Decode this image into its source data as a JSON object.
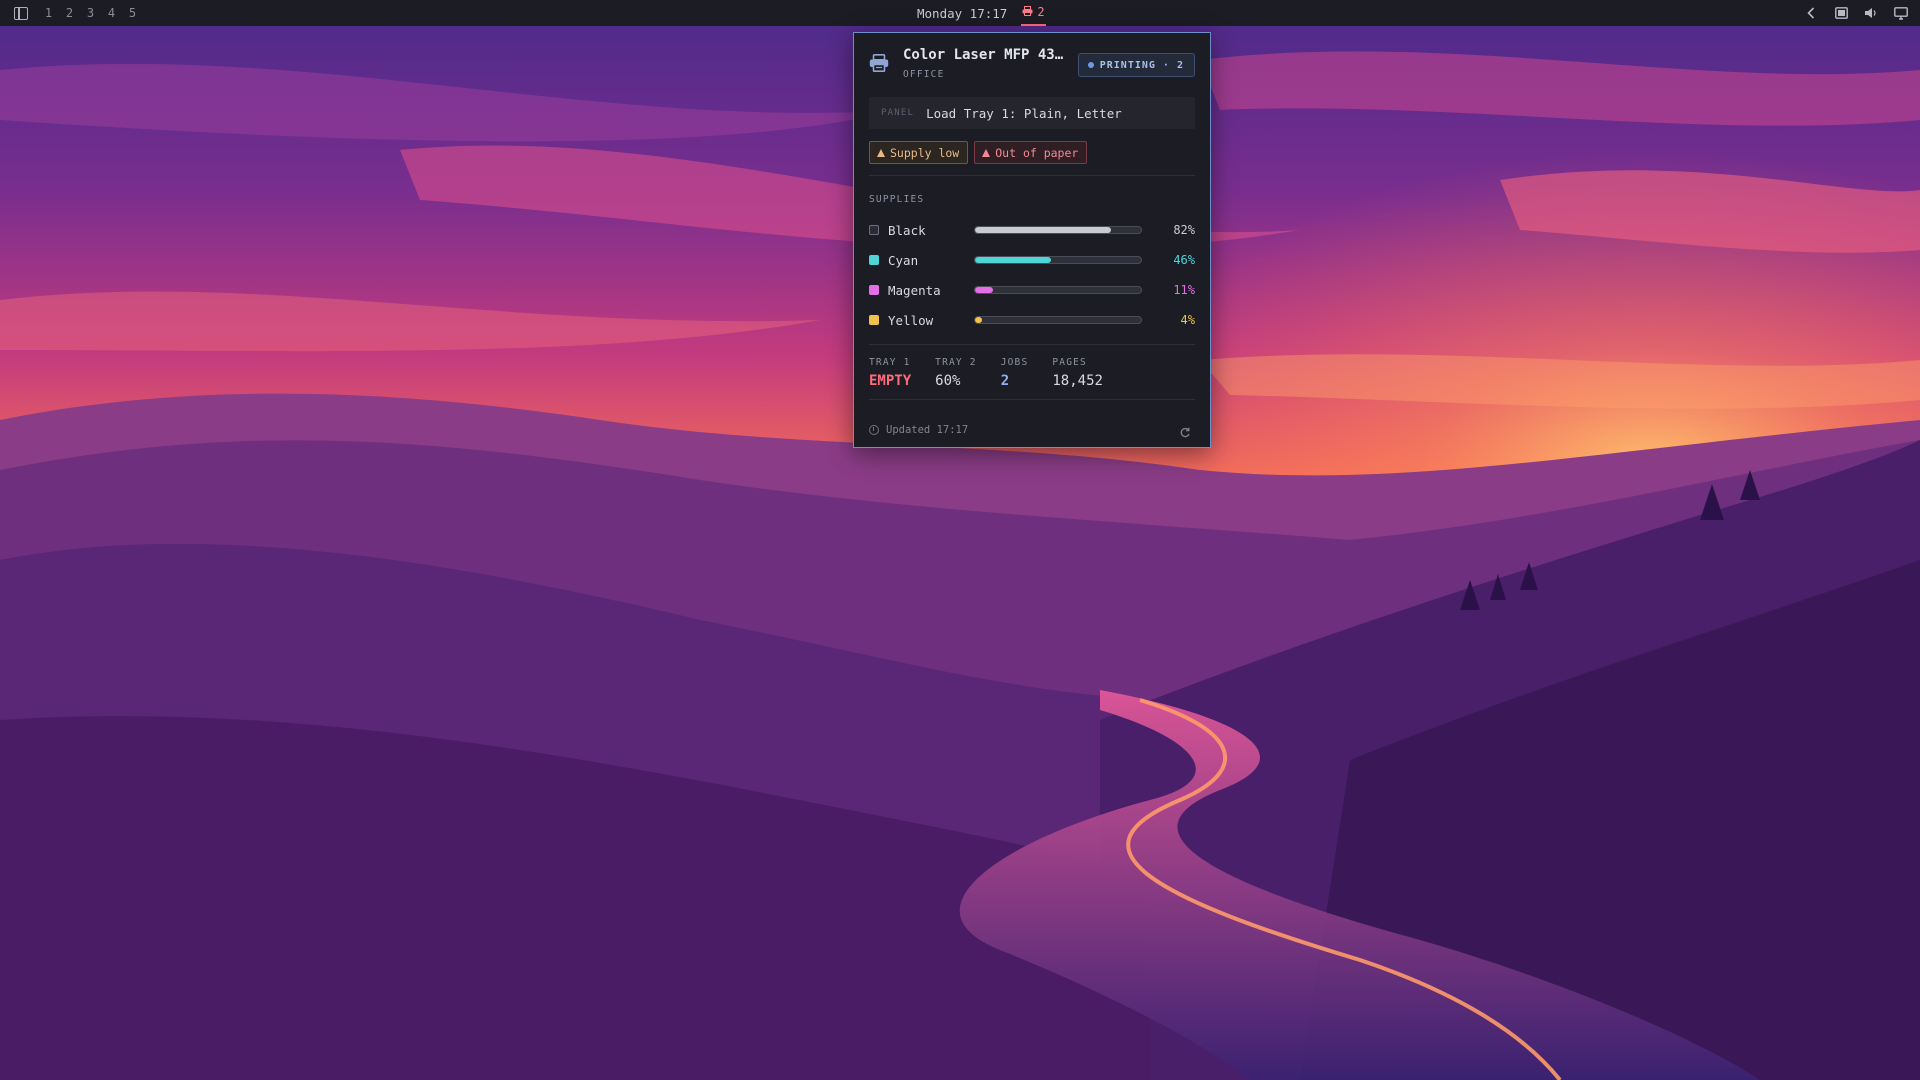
{
  "topbar": {
    "workspaces": [
      "1",
      "2",
      "3",
      "4",
      "5"
    ],
    "clock": "Monday 17:17",
    "print_jobs_count": "2",
    "icons": [
      "layout-icon",
      "printer-icon",
      "chevron-left-icon",
      "window-icon",
      "volume-icon",
      "display-icon"
    ]
  },
  "printer": {
    "name": "Color Laser MFP 43…",
    "location": "OFFICE",
    "status": "PRINTING · 2",
    "panel_tag": "PANEL",
    "panel_message": "Load Tray 1: Plain, Letter",
    "alerts": [
      {
        "label": "Supply low",
        "level": "warning"
      },
      {
        "label": "Out of paper",
        "level": "critical"
      }
    ],
    "supplies_label": "SUPPLIES",
    "supplies": [
      {
        "name": "Black",
        "percent": 82,
        "percent_text": "82%",
        "color": "#c9cbd3",
        "text_color": "#c9cbd3"
      },
      {
        "name": "Cyan",
        "percent": 46,
        "percent_text": "46%",
        "color": "#4fd4d8",
        "text_color": "#4fd4d8"
      },
      {
        "name": "Magenta",
        "percent": 11,
        "percent_text": "11%",
        "color": "#e46ee6",
        "text_color": "#e46ee6"
      },
      {
        "name": "Yellow",
        "percent": 4,
        "percent_text": "4%",
        "color": "#f2c24a",
        "text_color": "#f2c24a"
      }
    ],
    "stats": [
      {
        "label": "TRAY 1",
        "value": "EMPTY"
      },
      {
        "label": "TRAY 2",
        "value": "60%"
      },
      {
        "label": "JOBS",
        "value": "2"
      },
      {
        "label": "PAGES",
        "value": "18,452"
      }
    ],
    "updated": "Updated 17:17"
  },
  "colors": {
    "accent_border": "#6d8fc9",
    "critical": "#ff6b7a",
    "warning": "#eab98a"
  }
}
